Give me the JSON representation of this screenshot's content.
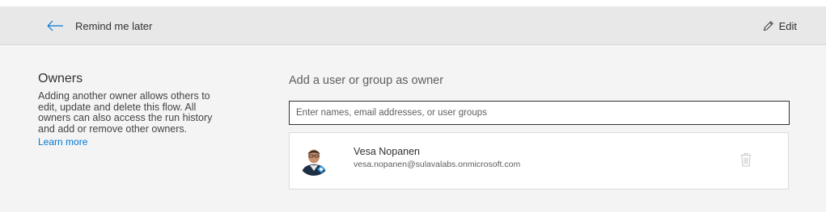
{
  "toolbar": {
    "back_label": "Remind me later",
    "edit_label": "Edit",
    "back_icon": "arrow-left-icon",
    "edit_icon": "pencil-icon"
  },
  "owners_section": {
    "title": "Owners",
    "description": "Adding another owner allows others to edit, update and delete this flow. All owners can also access the run history and add or remove other owners.",
    "learn_more": "Learn more"
  },
  "add_owner": {
    "title": "Add a user or group as owner",
    "input_value": "",
    "input_placeholder": "Enter names, email addresses, or user groups"
  },
  "owners": [
    {
      "name": "Vesa Nopanen",
      "email": "vesa.nopanen@sulavalabs.onmicrosoft.com",
      "avatar_icon": "user-photo-avatar",
      "delete_icon": "trash-icon"
    }
  ],
  "colors": {
    "accent": "#0078d4",
    "toolbar_bg": "#e8e8e8",
    "page_bg": "#f4f4f4"
  }
}
